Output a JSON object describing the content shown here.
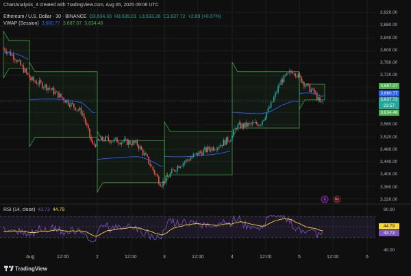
{
  "header": {
    "created_line": "ChartAnalysis_4 created with TradingView.com, Aug 05, 2025 09:06 UTC",
    "symbol": "Ethereum / U.S. Dollar · 30 · BINANCE",
    "ohlc": {
      "o": "O3,634.33",
      "h": "H3,639.01",
      "l": "L3,633.26",
      "c": "C3,637.72",
      "chg": "+2.69 (+0.07%)"
    },
    "vwap_label": "VWAP (Session)",
    "vwap_values": [
      "3,660.77",
      "3,687.07",
      "3,634.46"
    ],
    "rsi_label": "RSI (14, close)",
    "rsi_values": [
      "43.73",
      "44.79"
    ]
  },
  "price_axis": [
    "3,920.00",
    "3,880.00",
    "3,840.00",
    "3,800.00",
    "3,760.00",
    "3,720.00",
    "3,560.00",
    "3,520.00",
    "3,480.00",
    "3,440.00",
    "3,400.00",
    "3,360.00",
    "3,320.00"
  ],
  "price_tags": {
    "upper": "3,687.07",
    "vwap": "3,660.77",
    "price": "3,637.72",
    "countdown": "23:57",
    "lower": "3,634.46"
  },
  "rsi_axis": [
    "80.00",
    "40.00"
  ],
  "rsi_tags": {
    "signal": "44.79",
    "rsi": "43.73"
  },
  "time_axis": [
    "Aug",
    "12:00",
    "2",
    "12:00",
    "3",
    "12:00",
    "4",
    "12:00",
    "5",
    "12:00",
    "6"
  ],
  "footer": {
    "brand": "TradingView"
  },
  "colors": {
    "up": "#26a69a",
    "down": "#ef5350",
    "vwap": "#2962ff",
    "band": "#4caf50",
    "rsi": "#7e57c2",
    "rsi_ma": "#fdd835",
    "bg": "#0f0f0f"
  }
}
